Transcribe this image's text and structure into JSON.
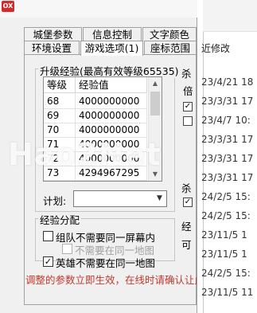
{
  "tabs_row1": [
    {
      "label": "城堡参数"
    },
    {
      "label": "信息控制"
    },
    {
      "label": "文字颜色"
    }
  ],
  "tabs_row2": [
    {
      "label": "环境设置"
    },
    {
      "label": "游戏选项(1)"
    },
    {
      "label": "座标范围"
    }
  ],
  "upgrade_group": {
    "title": "升级经验(最高有效等级65535)",
    "columns": [
      "等级",
      "经验值"
    ],
    "rows": [
      {
        "level": "68",
        "exp": "4000000000"
      },
      {
        "level": "69",
        "exp": "4000000000"
      },
      {
        "level": "70",
        "exp": "4000000000"
      },
      {
        "level": "71",
        "exp": "4000000000"
      },
      {
        "level": "72",
        "exp": "4000000000"
      },
      {
        "level": "73",
        "exp": "4294967295"
      }
    ]
  },
  "plan": {
    "label": "计划:",
    "value": ""
  },
  "exp_distribution": {
    "title": "经验分配",
    "options": [
      {
        "label": "组队不需要同一屏幕内",
        "checked": false,
        "enabled": true
      },
      {
        "label": "不需要在同一地图",
        "checked": false,
        "enabled": false
      },
      {
        "label": "英雄不需要在同一地图",
        "checked": true,
        "enabled": true
      }
    ]
  },
  "status_text": "调整的参数立即生效，在线时请确认让此",
  "right_fragments": [
    "杀",
    "倍",
    "杀",
    "经",
    "可"
  ],
  "background_window": {
    "column_header": "近修改",
    "dates": [
      "23/4/21 18",
      "23/3/31 17",
      "23/4/7 10:",
      "23/3/31 17",
      "23/3/31 17",
      "23/3/31 17",
      "24/2/5 15:",
      "24/2/5 15:",
      "23/11/5 1",
      "23/11/5 1",
      "24/2/5 15:",
      "23/11/5 11"
    ]
  },
  "watermark": "Hao2Net",
  "icons": {
    "close": "close-icon",
    "dropdown": "chevron-down-icon",
    "scroll_up": "arrow-up-icon",
    "scroll_down": "arrow-down-icon",
    "checkmark": "checkmark-icon"
  },
  "colors": {
    "status_text": "#c0392b",
    "close_button": "#d42a2a",
    "dialog_bg": "#f0f0f0"
  }
}
